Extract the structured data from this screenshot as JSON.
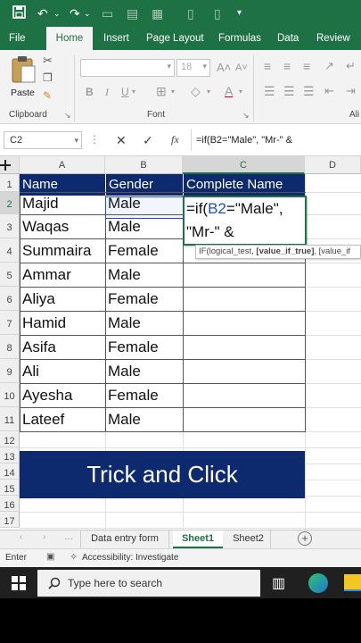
{
  "qat": {
    "save_icon": "save-icon",
    "undo_icon": "undo-icon",
    "redo_icon": "redo-icon",
    "more_icon": "customize-qat-icon"
  },
  "tabs": [
    "File",
    "Home",
    "Insert",
    "Page Layout",
    "Formulas",
    "Data",
    "Review"
  ],
  "active_tab": "Home",
  "ribbon": {
    "paste_label": "Paste",
    "clipboard_label": "Clipboard",
    "font_label": "Font",
    "alignment_label": "Ali",
    "font_size": "18",
    "bold": "B",
    "italic": "I",
    "underline": "U"
  },
  "formula_bar": {
    "name_box": "C2",
    "fx": "fx",
    "content": "=if(B2=\"Male\", \"Mr-\" &"
  },
  "columns": [
    "A",
    "B",
    "C",
    "D"
  ],
  "selected_column": "C",
  "rows": [
    "1",
    "2",
    "3",
    "4",
    "5",
    "6",
    "7",
    "8",
    "9",
    "10",
    "11",
    "12",
    "13",
    "14",
    "15",
    "16",
    "17"
  ],
  "selected_row": "2",
  "table": {
    "headers": [
      "Name",
      "Gender",
      "Complete Name"
    ],
    "rows": [
      [
        "Majid",
        "Male"
      ],
      [
        "Waqas",
        "Male"
      ],
      [
        "Summaira",
        "Female"
      ],
      [
        "Ammar",
        "Male"
      ],
      [
        "Aliya",
        "Female"
      ],
      [
        "Hamid",
        "Male"
      ],
      [
        "Asifa",
        "Female"
      ],
      [
        "Ali",
        "Male"
      ],
      [
        "Ayesha",
        "Female"
      ],
      [
        "Lateef",
        "Male"
      ]
    ]
  },
  "editing_cell": {
    "line1_prefix": "=if(",
    "line1_ref": "B2",
    "line1_suffix": "=\"Male\",",
    "line2": "\"Mr-\" &"
  },
  "tooltip": {
    "prefix": "IF(logical_test, ",
    "bold": "[value_if_true]",
    "suffix": ", [value_if"
  },
  "banner_text": "Trick and Click",
  "sheet_tabs": [
    "Data entry form",
    "Sheet1",
    "Sheet2"
  ],
  "active_sheet": "Sheet1",
  "status": {
    "mode": "Enter",
    "accessibility": "Accessibility: Investigate"
  },
  "taskbar": {
    "search_placeholder": "Type here to search"
  },
  "colors": {
    "excel_green": "#1e7145",
    "header_navy": "#0e2a6e",
    "ref_blue": "#1f4fb4"
  }
}
